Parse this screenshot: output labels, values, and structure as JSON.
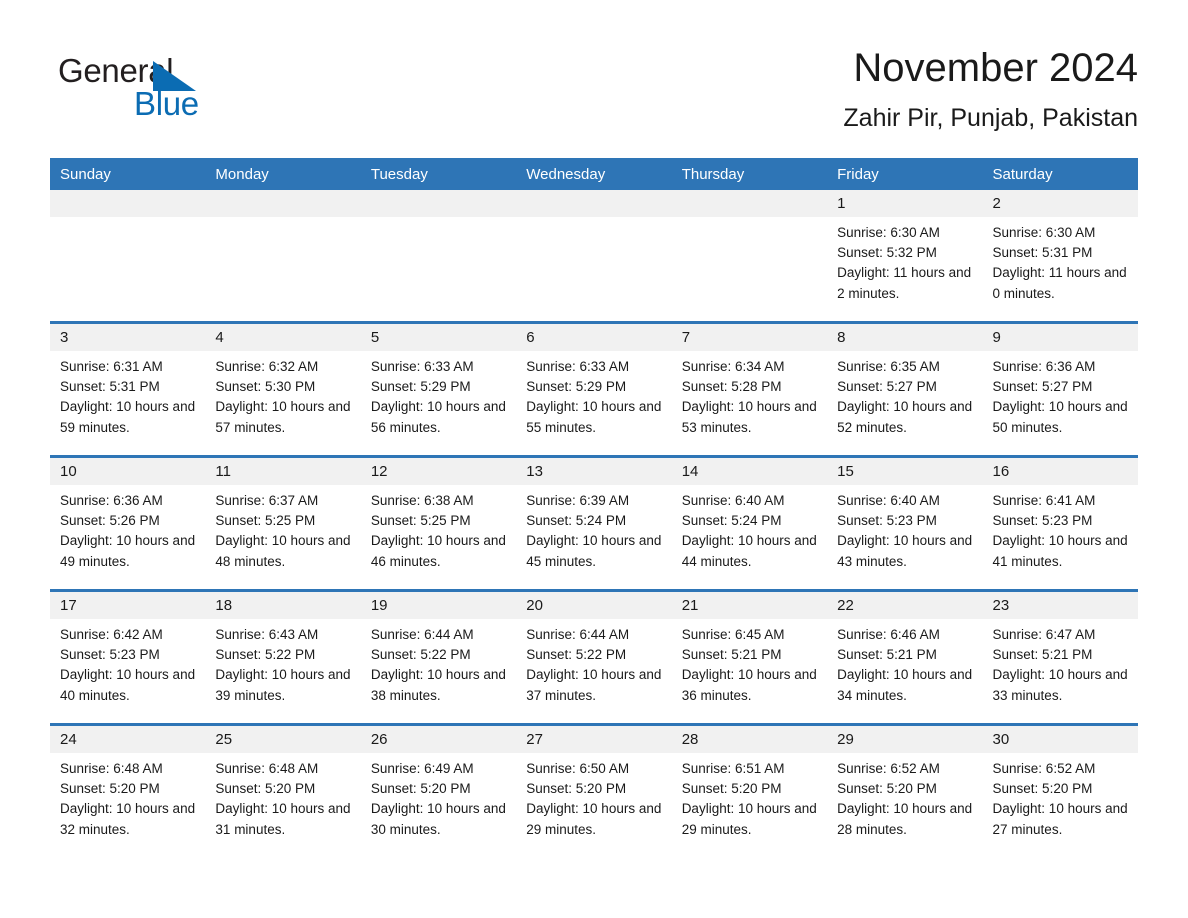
{
  "brand": {
    "word_one": "General",
    "word_two": "Blue",
    "triangle_icon": "triangle-icon",
    "accent_color": "#0b6cb3"
  },
  "header": {
    "title": "November 2024",
    "subtitle": "Zahir Pir, Punjab, Pakistan"
  },
  "theme": {
    "header_blue": "#2e75b6",
    "daynum_grey": "#f1f1f1",
    "text": "#1a1a1a"
  },
  "weekday_headers": [
    "Sunday",
    "Monday",
    "Tuesday",
    "Wednesday",
    "Thursday",
    "Friday",
    "Saturday"
  ],
  "weeks": [
    [
      {
        "day": "",
        "sunrise": "",
        "sunset": "",
        "daylight": ""
      },
      {
        "day": "",
        "sunrise": "",
        "sunset": "",
        "daylight": ""
      },
      {
        "day": "",
        "sunrise": "",
        "sunset": "",
        "daylight": ""
      },
      {
        "day": "",
        "sunrise": "",
        "sunset": "",
        "daylight": ""
      },
      {
        "day": "",
        "sunrise": "",
        "sunset": "",
        "daylight": ""
      },
      {
        "day": "1",
        "sunrise": "Sunrise: 6:30 AM",
        "sunset": "Sunset: 5:32 PM",
        "daylight": "Daylight: 11 hours and 2 minutes."
      },
      {
        "day": "2",
        "sunrise": "Sunrise: 6:30 AM",
        "sunset": "Sunset: 5:31 PM",
        "daylight": "Daylight: 11 hours and 0 minutes."
      }
    ],
    [
      {
        "day": "3",
        "sunrise": "Sunrise: 6:31 AM",
        "sunset": "Sunset: 5:31 PM",
        "daylight": "Daylight: 10 hours and 59 minutes."
      },
      {
        "day": "4",
        "sunrise": "Sunrise: 6:32 AM",
        "sunset": "Sunset: 5:30 PM",
        "daylight": "Daylight: 10 hours and 57 minutes."
      },
      {
        "day": "5",
        "sunrise": "Sunrise: 6:33 AM",
        "sunset": "Sunset: 5:29 PM",
        "daylight": "Daylight: 10 hours and 56 minutes."
      },
      {
        "day": "6",
        "sunrise": "Sunrise: 6:33 AM",
        "sunset": "Sunset: 5:29 PM",
        "daylight": "Daylight: 10 hours and 55 minutes."
      },
      {
        "day": "7",
        "sunrise": "Sunrise: 6:34 AM",
        "sunset": "Sunset: 5:28 PM",
        "daylight": "Daylight: 10 hours and 53 minutes."
      },
      {
        "day": "8",
        "sunrise": "Sunrise: 6:35 AM",
        "sunset": "Sunset: 5:27 PM",
        "daylight": "Daylight: 10 hours and 52 minutes."
      },
      {
        "day": "9",
        "sunrise": "Sunrise: 6:36 AM",
        "sunset": "Sunset: 5:27 PM",
        "daylight": "Daylight: 10 hours and 50 minutes."
      }
    ],
    [
      {
        "day": "10",
        "sunrise": "Sunrise: 6:36 AM",
        "sunset": "Sunset: 5:26 PM",
        "daylight": "Daylight: 10 hours and 49 minutes."
      },
      {
        "day": "11",
        "sunrise": "Sunrise: 6:37 AM",
        "sunset": "Sunset: 5:25 PM",
        "daylight": "Daylight: 10 hours and 48 minutes."
      },
      {
        "day": "12",
        "sunrise": "Sunrise: 6:38 AM",
        "sunset": "Sunset: 5:25 PM",
        "daylight": "Daylight: 10 hours and 46 minutes."
      },
      {
        "day": "13",
        "sunrise": "Sunrise: 6:39 AM",
        "sunset": "Sunset: 5:24 PM",
        "daylight": "Daylight: 10 hours and 45 minutes."
      },
      {
        "day": "14",
        "sunrise": "Sunrise: 6:40 AM",
        "sunset": "Sunset: 5:24 PM",
        "daylight": "Daylight: 10 hours and 44 minutes."
      },
      {
        "day": "15",
        "sunrise": "Sunrise: 6:40 AM",
        "sunset": "Sunset: 5:23 PM",
        "daylight": "Daylight: 10 hours and 43 minutes."
      },
      {
        "day": "16",
        "sunrise": "Sunrise: 6:41 AM",
        "sunset": "Sunset: 5:23 PM",
        "daylight": "Daylight: 10 hours and 41 minutes."
      }
    ],
    [
      {
        "day": "17",
        "sunrise": "Sunrise: 6:42 AM",
        "sunset": "Sunset: 5:23 PM",
        "daylight": "Daylight: 10 hours and 40 minutes."
      },
      {
        "day": "18",
        "sunrise": "Sunrise: 6:43 AM",
        "sunset": "Sunset: 5:22 PM",
        "daylight": "Daylight: 10 hours and 39 minutes."
      },
      {
        "day": "19",
        "sunrise": "Sunrise: 6:44 AM",
        "sunset": "Sunset: 5:22 PM",
        "daylight": "Daylight: 10 hours and 38 minutes."
      },
      {
        "day": "20",
        "sunrise": "Sunrise: 6:44 AM",
        "sunset": "Sunset: 5:22 PM",
        "daylight": "Daylight: 10 hours and 37 minutes."
      },
      {
        "day": "21",
        "sunrise": "Sunrise: 6:45 AM",
        "sunset": "Sunset: 5:21 PM",
        "daylight": "Daylight: 10 hours and 36 minutes."
      },
      {
        "day": "22",
        "sunrise": "Sunrise: 6:46 AM",
        "sunset": "Sunset: 5:21 PM",
        "daylight": "Daylight: 10 hours and 34 minutes."
      },
      {
        "day": "23",
        "sunrise": "Sunrise: 6:47 AM",
        "sunset": "Sunset: 5:21 PM",
        "daylight": "Daylight: 10 hours and 33 minutes."
      }
    ],
    [
      {
        "day": "24",
        "sunrise": "Sunrise: 6:48 AM",
        "sunset": "Sunset: 5:20 PM",
        "daylight": "Daylight: 10 hours and 32 minutes."
      },
      {
        "day": "25",
        "sunrise": "Sunrise: 6:48 AM",
        "sunset": "Sunset: 5:20 PM",
        "daylight": "Daylight: 10 hours and 31 minutes."
      },
      {
        "day": "26",
        "sunrise": "Sunrise: 6:49 AM",
        "sunset": "Sunset: 5:20 PM",
        "daylight": "Daylight: 10 hours and 30 minutes."
      },
      {
        "day": "27",
        "sunrise": "Sunrise: 6:50 AM",
        "sunset": "Sunset: 5:20 PM",
        "daylight": "Daylight: 10 hours and 29 minutes."
      },
      {
        "day": "28",
        "sunrise": "Sunrise: 6:51 AM",
        "sunset": "Sunset: 5:20 PM",
        "daylight": "Daylight: 10 hours and 29 minutes."
      },
      {
        "day": "29",
        "sunrise": "Sunrise: 6:52 AM",
        "sunset": "Sunset: 5:20 PM",
        "daylight": "Daylight: 10 hours and 28 minutes."
      },
      {
        "day": "30",
        "sunrise": "Sunrise: 6:52 AM",
        "sunset": "Sunset: 5:20 PM",
        "daylight": "Daylight: 10 hours and 27 minutes."
      }
    ]
  ]
}
